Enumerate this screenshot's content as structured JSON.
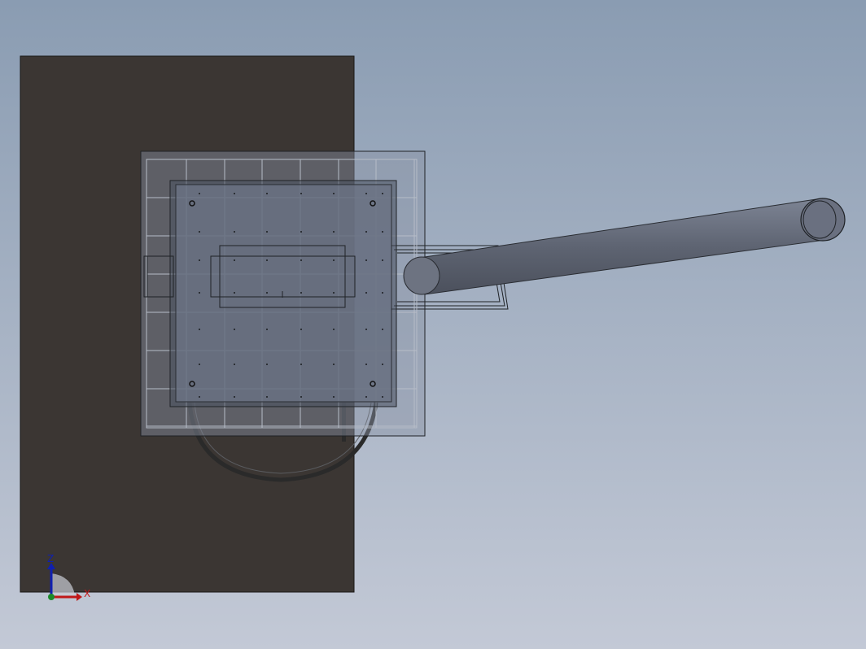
{
  "viewport": {
    "background_top": "#8a9cb2",
    "background_bottom": "#c3c9d6"
  },
  "model": {
    "base_slab_color": "#3b3633",
    "panel_fill": "#6d7687",
    "panel_stroke": "#1f2226",
    "wireframe_color": "#b7bdc8",
    "pipe_color": "#5e6472",
    "pipe_highlight": "#7d8494",
    "hoop_color": "#2a2a2a"
  },
  "triad": {
    "z_label": "Z",
    "x_label": "X",
    "z_color": "#1020b0",
    "x_color": "#c01818",
    "origin_color": "#1a8a2a"
  }
}
